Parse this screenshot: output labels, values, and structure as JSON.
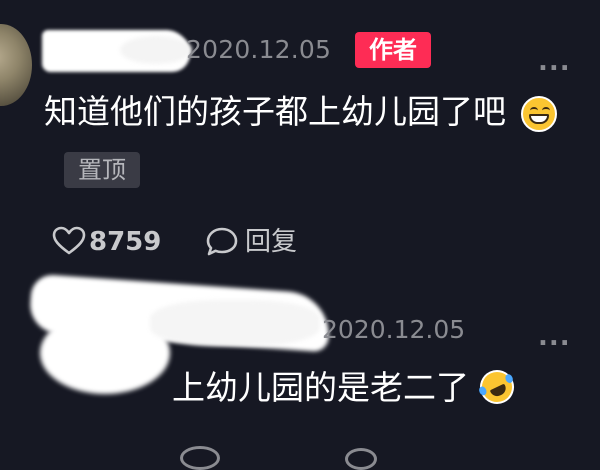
{
  "comments": [
    {
      "date": "2020.12.05",
      "badge": "作者",
      "more": "...",
      "text": "知道他们的孩子都上幼儿园了吧",
      "emoji": "grinning-face",
      "pinned_label": "置顶",
      "like_count": "8759",
      "reply_label": "回复"
    },
    {
      "date": "2020.12.05",
      "more": "...",
      "text": "上幼儿园的是老二了",
      "emoji": "rolling-on-floor-laughing"
    }
  ],
  "icons": [
    "heart-icon",
    "comment-bubble-icon",
    "more-dots-icon"
  ],
  "colors": {
    "background": "#161823",
    "author_badge": "#fe2c55",
    "muted_text": "#8a8b91",
    "pin_badge_bg": "#3a3b45"
  }
}
